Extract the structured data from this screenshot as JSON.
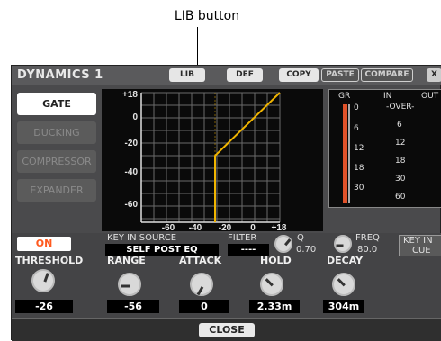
{
  "callout": {
    "label": "LIB button"
  },
  "window": {
    "title": "DYNAMICS 1",
    "buttons": {
      "lib": "LIB",
      "def": "DEF",
      "copy": "COPY",
      "paste": "PASTE",
      "compare": "COMPARE",
      "close_x": "X"
    }
  },
  "types": [
    "GATE",
    "DUCKING",
    "COMPRESSOR",
    "EXPANDER"
  ],
  "graph": {
    "y_ticks": [
      "+18",
      "0",
      "-20",
      "-40",
      "-60"
    ],
    "x_ticks": [
      "-60",
      "-40",
      "-20",
      "0",
      "+18"
    ]
  },
  "meter": {
    "headers": {
      "gr": "GR",
      "in": "IN",
      "out": "OUT"
    },
    "gr_scale": [
      "0",
      "6",
      "12",
      "18",
      "30"
    ],
    "in_scale": [
      "-OVER-",
      "6",
      "12",
      "18",
      "30",
      "60"
    ]
  },
  "on_button": "ON",
  "key_in": {
    "label": "KEY IN SOURCE",
    "value": "SELF POST EQ"
  },
  "filter": {
    "label": "FILTER",
    "value": "----",
    "q_label": "Q",
    "q_value": "0.70",
    "freq_label": "FREQ",
    "freq_value": "80.0"
  },
  "key_in_cue": {
    "label": "KEY IN",
    "value": "CUE"
  },
  "params": {
    "threshold": {
      "label": "THRESHOLD",
      "value": "-26"
    },
    "range": {
      "label": "RANGE",
      "value": "-56"
    },
    "attack": {
      "label": "ATTACK",
      "value": "0"
    },
    "hold": {
      "label": "HOLD",
      "value": "2.33m"
    },
    "decay": {
      "label": "DECAY",
      "value": "304m"
    }
  },
  "close_button": "CLOSE"
}
